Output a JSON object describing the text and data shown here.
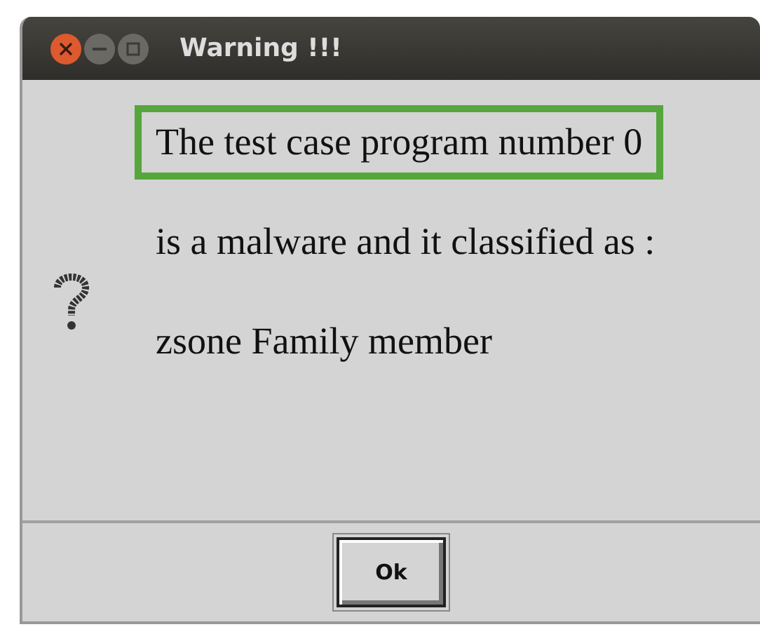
{
  "window": {
    "title": "Warning !!!"
  },
  "message_lines": [
    {
      "text": "The test case program number 0",
      "highlighted": true
    },
    {
      "text": "is a malware and it classified as :",
      "highlighted": false
    },
    {
      "text": "zsone Family member",
      "highlighted": false
    }
  ],
  "buttons": [
    {
      "label": "Ok"
    }
  ]
}
